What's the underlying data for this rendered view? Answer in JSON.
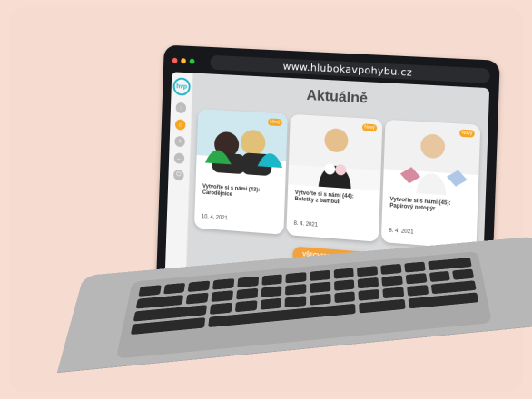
{
  "browser": {
    "url": "www.hlubokavpohybu.cz",
    "window_dots": [
      "#ff5f57",
      "#febc2e",
      "#28c840"
    ]
  },
  "sidebar": {
    "logo_text": "hvp",
    "items": [
      {
        "label": "",
        "icon": "profile-icon",
        "active": false
      },
      {
        "label": "",
        "icon": "home-icon",
        "active": true
      },
      {
        "label": "",
        "icon": "activity-icon",
        "active": false
      },
      {
        "label": "",
        "icon": "back-icon",
        "active": false
      },
      {
        "label": "",
        "icon": "power-icon",
        "active": false
      }
    ]
  },
  "main": {
    "title": "Aktuálně",
    "cards": [
      {
        "badge": "Nový",
        "title": "Vytvořte si s námi (43): Čarodějnice",
        "date": "10. 4. 2021"
      },
      {
        "badge": "Nový",
        "title": "Vytvořte si s námi (44): Boletky z bambulí",
        "date": "8. 4. 2021"
      },
      {
        "badge": "Nový",
        "title": "Vytvořte si s námi (45): Papírový netopýr",
        "date": "8. 4. 2021"
      }
    ],
    "cta_label": "VŠECHNY AKTUALITY"
  },
  "colors": {
    "accent": "#f5a623",
    "page_bg": "#f7ddd2",
    "screen_bg": "#d9dadb",
    "laptop_bezel": "#17181b"
  }
}
